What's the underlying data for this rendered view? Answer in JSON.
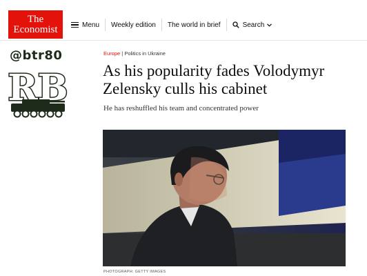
{
  "header": {
    "logo_line1": "The",
    "logo_line2": "Economist",
    "nav": {
      "menu_label": "Menu",
      "weekly_label": "Weekly edition",
      "brief_label": "The world in brief",
      "search_label": "Search"
    }
  },
  "watermark": {
    "handle": "@btr80",
    "monogram": "RB"
  },
  "article": {
    "section": "Europe",
    "separator": "|",
    "topic": "Politics in Ukraine",
    "headline": "As his popularity fades Volodymyr Zelensky culls his cabinet",
    "subhead": "He has reshuffled his team and concentrated power",
    "photo_credit": "PHOTOGRAPH: GETTY IMAGES"
  },
  "colors": {
    "brand_red": "#e3120b",
    "text": "#0d0d0d",
    "watermark_green": "#1e2a1a"
  }
}
